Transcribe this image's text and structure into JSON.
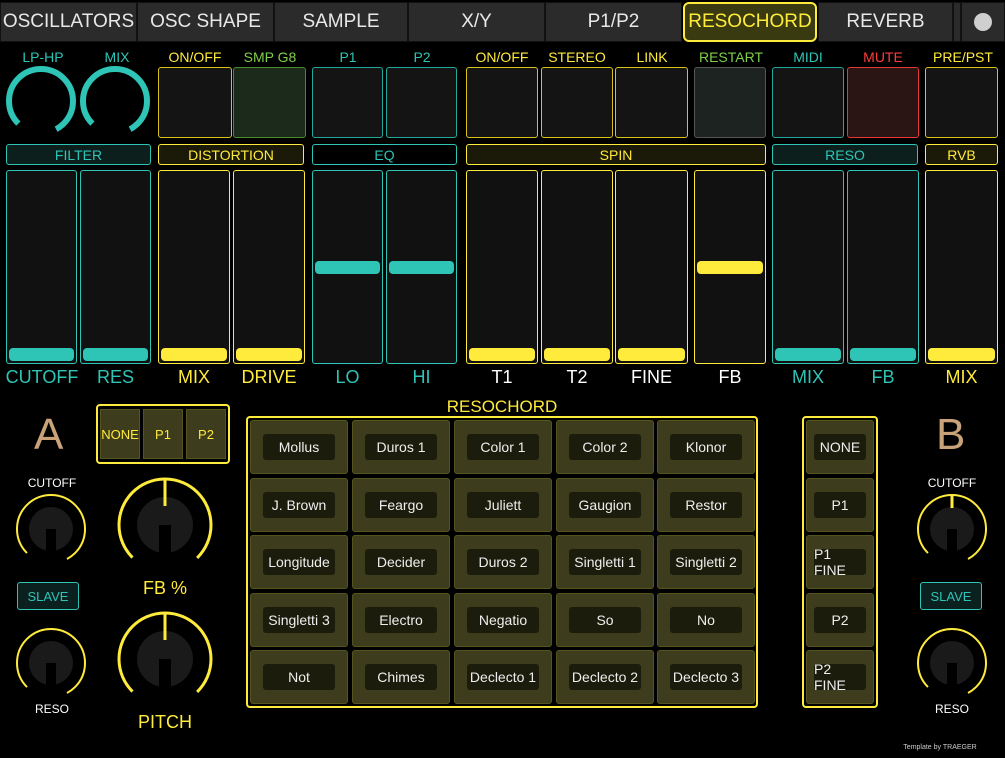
{
  "tabs": [
    "OSCILLATORS",
    "OSC SHAPE",
    "SAMPLE",
    "X/Y",
    "P1/P2",
    "RESOCHORD",
    "REVERB"
  ],
  "active_tab": "RESOCHORD",
  "top": {
    "lp_hp": "LP-HP",
    "mix": "MIX",
    "dist_on": "ON/OFF",
    "smp_g8": "SMP G8",
    "p1": "P1",
    "p2": "P2",
    "spin_on": "ON/OFF",
    "stereo": "STEREO",
    "link": "LINK",
    "restart": "RESTART",
    "midi": "MIDI",
    "mute": "MUTE",
    "pre_pst": "PRE/PST"
  },
  "sections": {
    "filter": "FILTER",
    "distortion": "DISTORTION",
    "eq": "EQ",
    "spin": "SPIN",
    "reso": "RESO",
    "rvb": "RVB"
  },
  "faders": [
    {
      "label": "CUTOFF",
      "level": 0.0
    },
    {
      "label": "RES",
      "level": 0.0
    },
    {
      "label": "MIX",
      "level": 0.0
    },
    {
      "label": "DRIVE",
      "level": 0.0
    },
    {
      "label": "LO",
      "level": 0.5
    },
    {
      "label": "HI",
      "level": 0.5
    },
    {
      "label": "T1",
      "level": 0.0
    },
    {
      "label": "T2",
      "level": 0.0
    },
    {
      "label": "FINE",
      "level": 0.0
    },
    {
      "label": "FB",
      "level": 0.5
    },
    {
      "label": "MIX",
      "level": 0.0
    },
    {
      "label": "FB",
      "level": 0.0
    },
    {
      "label": "MIX",
      "level": 0.0
    }
  ],
  "resochord": {
    "title": "RESOCHORD",
    "presets": [
      [
        "Mollus",
        "Duros 1",
        "Color 1",
        "Color 2",
        "Klonor"
      ],
      [
        "J. Brown",
        "Feargo",
        "Juliett",
        "Gaugion",
        "Restor"
      ],
      [
        "Longitude",
        "Decider",
        "Duros 2",
        "Singletti 1",
        "Singletti 2"
      ],
      [
        "Singletti 3",
        "Electro",
        "Negatio",
        "So",
        "No"
      ],
      [
        "Not",
        "Chimes",
        "Declecto 1",
        "Declecto 2",
        "Declecto 3"
      ]
    ]
  },
  "side_a": {
    "letter": "A",
    "cutoff": "CUTOFF",
    "slave": "SLAVE",
    "reso": "RESO",
    "mod_buttons": [
      "NONE",
      "P1",
      "P2"
    ],
    "fb": "FB %",
    "pitch": "PITCH"
  },
  "side_b": {
    "letter": "B",
    "cutoff": "CUTOFF",
    "slave": "SLAVE",
    "reso": "RESO",
    "mod_buttons": [
      "NONE",
      "P1",
      "P1 FINE",
      "P2",
      "P2 FINE"
    ]
  },
  "credit": "Template by TRAEGER",
  "colors": {
    "teal": "#2ec4b6",
    "yellow": "#ffeb3b",
    "green": "#7dcf4a",
    "red": "#ff3b3b"
  }
}
